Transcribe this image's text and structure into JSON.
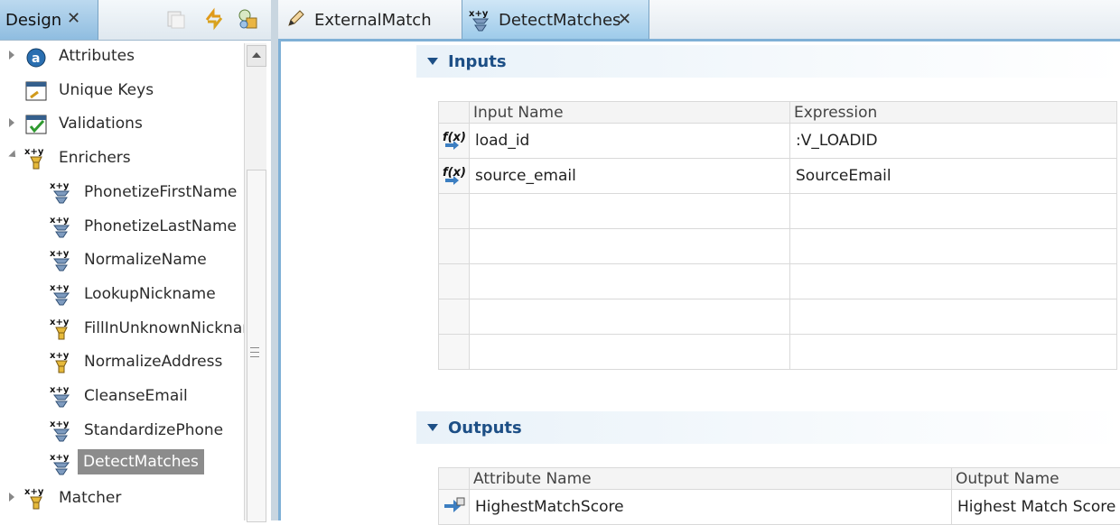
{
  "left_panel": {
    "tab_label": "Design",
    "tree": [
      {
        "label": "Attributes",
        "icon": "attributes-icon",
        "expander": "collapsed",
        "indent": 0
      },
      {
        "label": "Unique Keys",
        "icon": "unique-keys-icon",
        "expander": "none",
        "indent": 0
      },
      {
        "label": "Validations",
        "icon": "validations-icon",
        "expander": "collapsed",
        "indent": 0
      },
      {
        "label": "Enrichers",
        "icon": "enrichers-icon",
        "expander": "expanded",
        "indent": 0
      },
      {
        "label": "PhonetizeFirstName",
        "icon": "enricher-icon",
        "expander": "none",
        "indent": 1
      },
      {
        "label": "PhonetizeLastName",
        "icon": "enricher-icon",
        "expander": "none",
        "indent": 1
      },
      {
        "label": "NormalizeName",
        "icon": "enricher-icon",
        "expander": "none",
        "indent": 1
      },
      {
        "label": "LookupNickname",
        "icon": "enricher-icon",
        "expander": "none",
        "indent": 1
      },
      {
        "label": "FillInUnknownNicknar",
        "icon": "enricher-yellow-icon",
        "expander": "none",
        "indent": 1
      },
      {
        "label": "NormalizeAddress",
        "icon": "enricher-yellow-icon",
        "expander": "none",
        "indent": 1
      },
      {
        "label": "CleanseEmail",
        "icon": "enricher-icon",
        "expander": "none",
        "indent": 1
      },
      {
        "label": "StandardizePhone",
        "icon": "enricher-icon",
        "expander": "none",
        "indent": 1
      },
      {
        "label": "DetectMatches",
        "icon": "enricher-icon",
        "expander": "none",
        "indent": 1,
        "selected": true
      },
      {
        "label": "Matcher",
        "icon": "matcher-icon",
        "expander": "collapsed",
        "indent": 0
      }
    ]
  },
  "editor": {
    "tabs": [
      {
        "label": "ExternalMatch",
        "icon": "pencil-icon",
        "active": false
      },
      {
        "label": "DetectMatches",
        "icon": "enricher-icon",
        "active": true
      }
    ],
    "inputs": {
      "title": "Inputs",
      "columns": [
        "Input Name",
        "Expression"
      ],
      "rows": [
        {
          "name": "load_id",
          "expression": ":V_LOADID"
        },
        {
          "name": "source_email",
          "expression": "SourceEmail"
        }
      ]
    },
    "outputs": {
      "title": "Outputs",
      "columns": [
        "Attribute Name",
        "Output Name"
      ],
      "rows": [
        {
          "name": "HighestMatchScore",
          "output": "Highest Match Score"
        }
      ]
    }
  },
  "colors": {
    "accent": "#1d4f86",
    "tab_active": "#9ecbea",
    "selection": "#8c8c8c"
  }
}
